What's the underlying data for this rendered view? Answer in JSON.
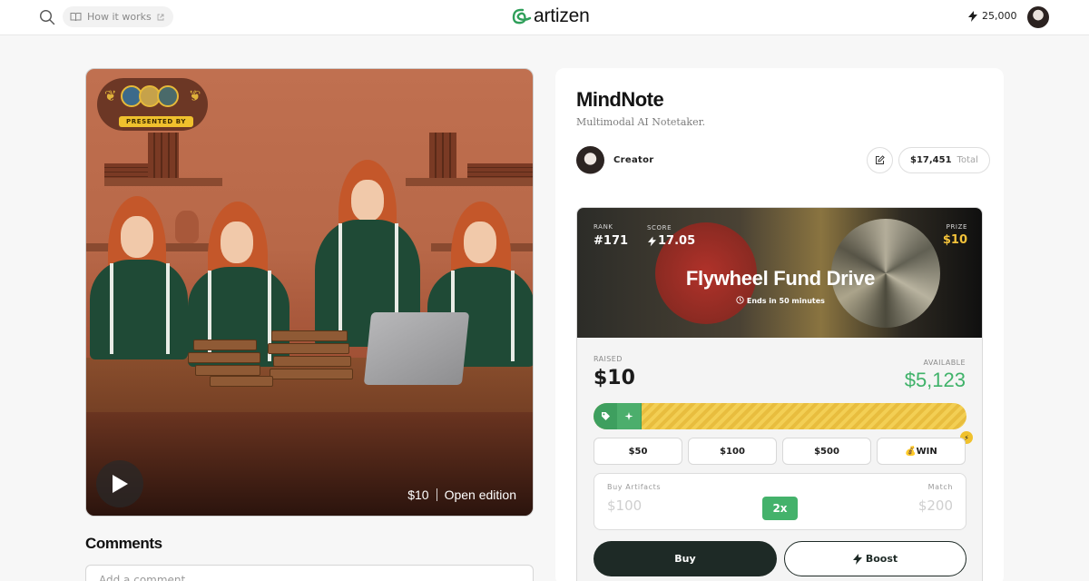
{
  "header": {
    "how_it_works": "How it works",
    "logo_text": "artizen",
    "points": "25,000",
    "icons": [
      "search-icon",
      "book-icon",
      "external-link-icon",
      "bolt-icon"
    ]
  },
  "media": {
    "presented_by": "PRESENTED BY",
    "price": "$10",
    "edition": "Open edition"
  },
  "comments": {
    "title": "Comments",
    "placeholder": "Add a comment..."
  },
  "project": {
    "title": "MindNote",
    "subtitle": "Multimodal AI Notetaker.",
    "creator": "Creator",
    "total_value": "$17,451",
    "total_label": "Total"
  },
  "fund": {
    "rank_label": "RANK",
    "rank": "#171",
    "score_label": "SCORE",
    "score": "17.05",
    "prize_label": "PRIZE",
    "prize": "$10",
    "title": "Flywheel Fund Drive",
    "ends": "Ends in 50 minutes",
    "raised_label": "RAISED",
    "raised": "$10",
    "available_label": "AVAILABLE",
    "available": "$5,123",
    "progress_fraction": 0.13,
    "amounts": [
      "$50",
      "$100",
      "$500",
      "WIN"
    ],
    "win_emoji": "💰",
    "buy_artifacts_label": "Buy Artifacts",
    "buy_artifacts_value": "$100",
    "multiplier": "2x",
    "match_label": "Match",
    "match_value": "$200",
    "buy_label": "Buy",
    "boost_label": "Boost"
  },
  "colors": {
    "accent_green": "#3fb269",
    "prize_gold": "#f3c23a",
    "button_dark": "#1e2a26"
  }
}
